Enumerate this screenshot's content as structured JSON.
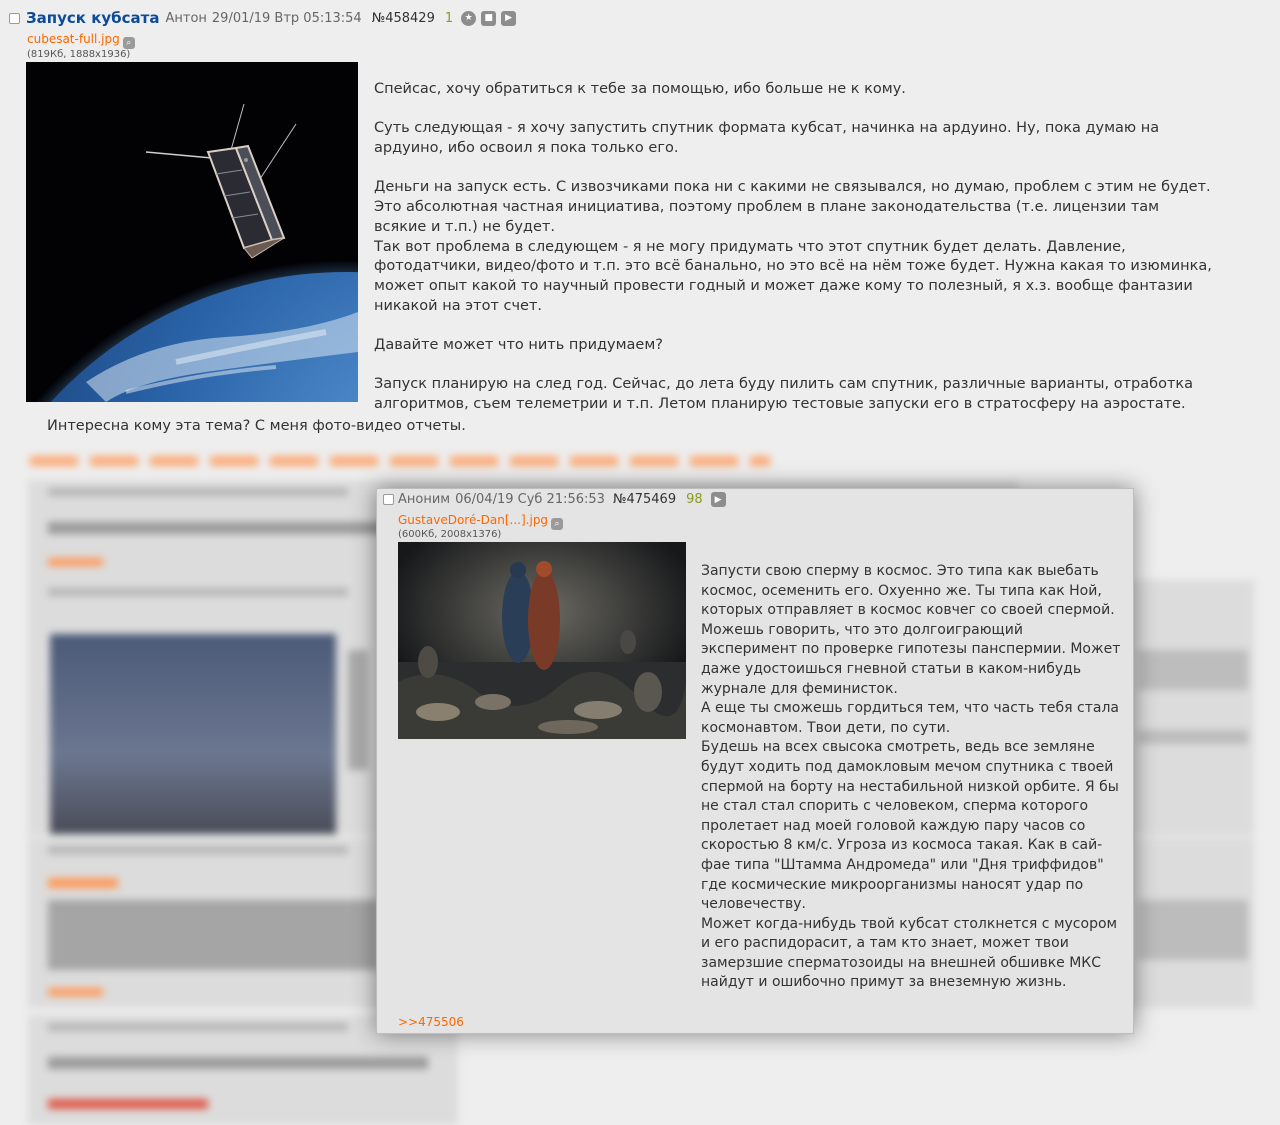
{
  "op": {
    "title": "Запуск кубсата",
    "author": "Антон",
    "datetime": "29/01/19 Втр 05:13:54",
    "number": "№458429",
    "count": "1",
    "file": {
      "name": "cubesat-full.jpg",
      "info": "(819Кб, 1888x1936)"
    },
    "paragraphs": [
      "Спейсас, хочу обратиться к тебе за помощью, ибо больше не к кому.",
      "Суть следующая - я хочу запустить спутник формата кубсат, начинка на ардуино. Ну, пока думаю на ардуино, ибо освоил я пока только его.",
      "Деньги на запуск есть. С извозчиками пока ни с какими не связывался, но думаю, проблем с этим не будет. Это абсолютная частная инициатива, поэтому проблем в плане законодательства (т.е. лицензии там всякие и т.п.) не будет.\nТак вот проблема в следующем - я не могу придумать что этот спутник будет делать. Давление, фотодатчики, видео/фото и т.п. это всё банально, но это всё на нём тоже будет. Нужна какая то изюминка, может опыт какой то научный провести годный и может даже кому то полезный, я х.з. вообще фантазии никакой на этот счет.",
      "Давайте может что нить придумаем?",
      "Запуск планирую на след год. Сейчас, до лета буду пилить сам спутник, различные варианты, отработка алгоритмов, съем телеметрии и т.п. Летом планирую тестовые запуски его в стратосферу на аэростате."
    ],
    "last_line": "Интересна кому эта тема? С меня фото-видео отчеты."
  },
  "popup": {
    "author": "Аноним",
    "datetime": "06/04/19 Суб 21:56:53",
    "number": "№475469",
    "count": "98",
    "file": {
      "name": "GustaveDoré-Dan[...].jpg",
      "info": "(600Кб, 2008x1376)"
    },
    "text": "Запусти свою сперму в космос. Это типа как выебать космос, осеменить его. Охуенно же. Ты типа как Ной, которых отправляет в космос ковчег со своей спермой. Можешь говорить, что это долгоиграющий эксперимент по проверке гипотезы панспермии. Может даже удостоишься гневной статьи в каком-нибудь журнале для феминисток.\nА еще ты сможешь гордиться тем, что часть тебя стала космонавтом. Твои дети, по сути.\nБудешь на всех свысока смотреть, ведь все земляне будут ходить под дамокловым мечом спутника с твоей спермой на борту на нестабильной низкой орбите. Я бы не стал стал спорить с человеком, сперма которого пролетает над моей головой каждую пару часов со скоростью 8 км/с. Угроза из космоса такая. Как в сай-фае типа \"Штамма Андромеда\" или \"Дня триффидов\" где космические микроорганизмы наносят удар по человечеству.\nМожет когда-нибудь твой кубсат столкнется с мусором и его распидорасит, а там кто знает, может твои замерзшие сперматозоиды на внешней обшивке МКС найдут и ошибочно примут за внеземную жизнь.",
    "reply_link": ">>475506"
  }
}
